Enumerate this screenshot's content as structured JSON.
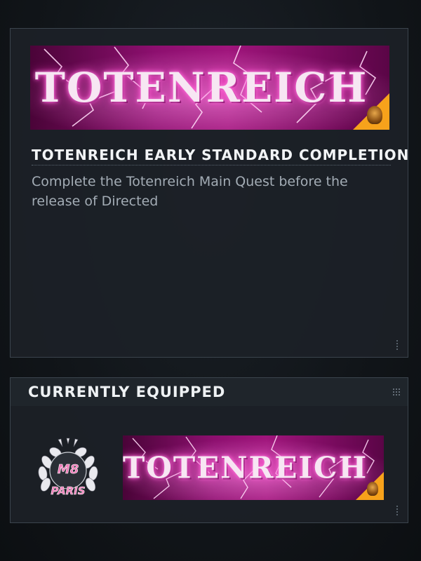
{
  "detail": {
    "banner_text": "TOTENREICH",
    "title": "TOTENREICH EARLY STANDARD COMPLETION",
    "description": "Complete the Totenreich Main Quest before the release of Directed"
  },
  "equipped": {
    "header": "CURRENTLY EQUIPPED",
    "emblem_text_top": "M8",
    "emblem_text_bottom": "PARIS",
    "banner_text": "TOTENREICH"
  },
  "colors": {
    "banner_magenta": "#a0157c",
    "corner_orange": "#f7a21b",
    "emblem_pink": "#f07ab8"
  },
  "icons": [
    "lightning-bolt-icon",
    "skull-icon",
    "grid-icon",
    "laurel-wreath-icon"
  ]
}
